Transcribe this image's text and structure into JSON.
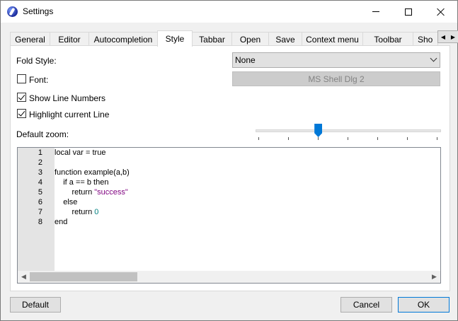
{
  "window": {
    "title": "Settings"
  },
  "tabs": [
    {
      "label": "General"
    },
    {
      "label": "Editor"
    },
    {
      "label": "Autocompletion"
    },
    {
      "label": "Style"
    },
    {
      "label": "Tabbar"
    },
    {
      "label": "Open"
    },
    {
      "label": "Save"
    },
    {
      "label": "Context menu"
    },
    {
      "label": "Toolbar"
    },
    {
      "label": "Sho"
    }
  ],
  "active_tab": "Style",
  "style": {
    "fold_style_label": "Fold Style:",
    "fold_style_value": "None",
    "font_label": "Font:",
    "font_checked": false,
    "font_button": "MS Shell Dlg 2",
    "show_line_numbers_label": "Show Line Numbers",
    "show_line_numbers_checked": true,
    "highlight_line_label": "Highlight current Line",
    "highlight_line_checked": true,
    "zoom_label": "Default zoom:",
    "zoom_position_fraction": 0.33
  },
  "editor": {
    "line_numbers": [
      "1",
      "2",
      "3",
      "4",
      "5",
      "6",
      "7",
      "8"
    ],
    "lines": [
      [
        {
          "t": "local var = true"
        }
      ],
      [],
      [
        {
          "t": "function example(a,b)"
        }
      ],
      [
        {
          "t": "    if a == b then"
        }
      ],
      [
        {
          "t": "        return "
        },
        {
          "t": "\"success\"",
          "c": "str"
        }
      ],
      [
        {
          "t": "    else"
        }
      ],
      [
        {
          "t": "        return "
        },
        {
          "t": "0",
          "c": "num"
        }
      ],
      [
        {
          "t": "end"
        }
      ]
    ]
  },
  "buttons": {
    "default": "Default",
    "cancel": "Cancel",
    "ok": "OK"
  },
  "colors": {
    "accent": "#0078d7",
    "string": "#7f007f",
    "number": "#007f7f"
  }
}
